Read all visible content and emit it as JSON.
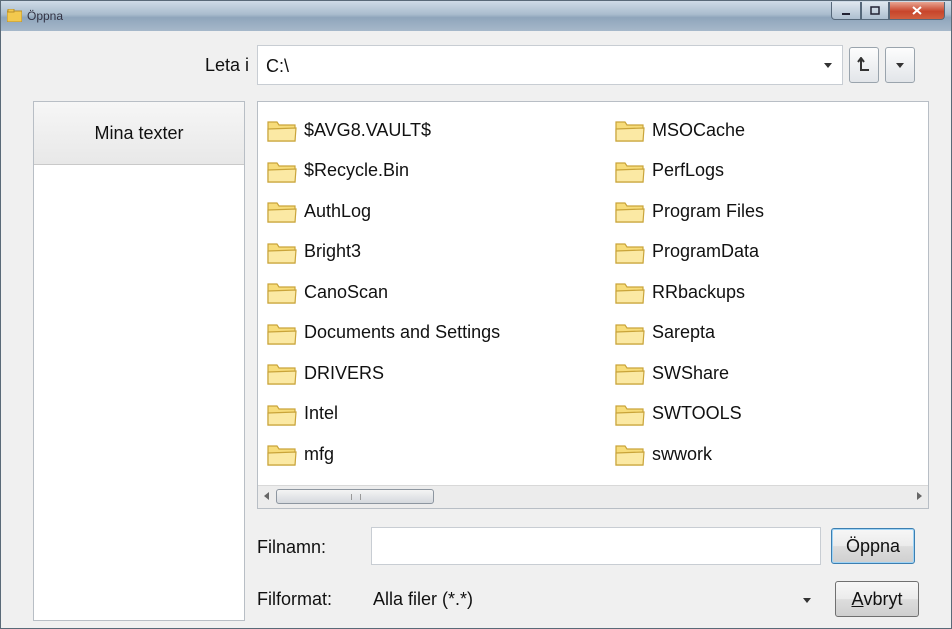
{
  "window": {
    "title": "Öppna"
  },
  "lookin": {
    "label": "Leta i",
    "value": "C:\\",
    "up_glyph": "⮤",
    "dropdown_glyph": "▾"
  },
  "places": {
    "items": [
      {
        "label": "Mina texter"
      }
    ]
  },
  "files": {
    "column1": [
      "$AVG8.VAULT$",
      "$Recycle.Bin",
      "AuthLog",
      "Bright3",
      "CanoScan",
      "Documents and Settings",
      "DRIVERS",
      "Intel",
      "mfg"
    ],
    "column2": [
      "MSOCache",
      "PerfLogs",
      "Program Files",
      "ProgramData",
      "RRbackups",
      "Sarepta",
      "SWShare",
      "SWTOOLS",
      "swwork"
    ]
  },
  "filename": {
    "label": "Filnamn:",
    "value": ""
  },
  "filetype": {
    "label": "Filformat:",
    "value": "Alla filer (*.*)"
  },
  "buttons": {
    "open": "Öppna",
    "cancel_first": "A",
    "cancel_rest": "vbryt"
  },
  "colors": {
    "folder_fill": "#f7dc7a",
    "folder_stroke": "#c9a43a",
    "accent": "#3c7fb1"
  }
}
